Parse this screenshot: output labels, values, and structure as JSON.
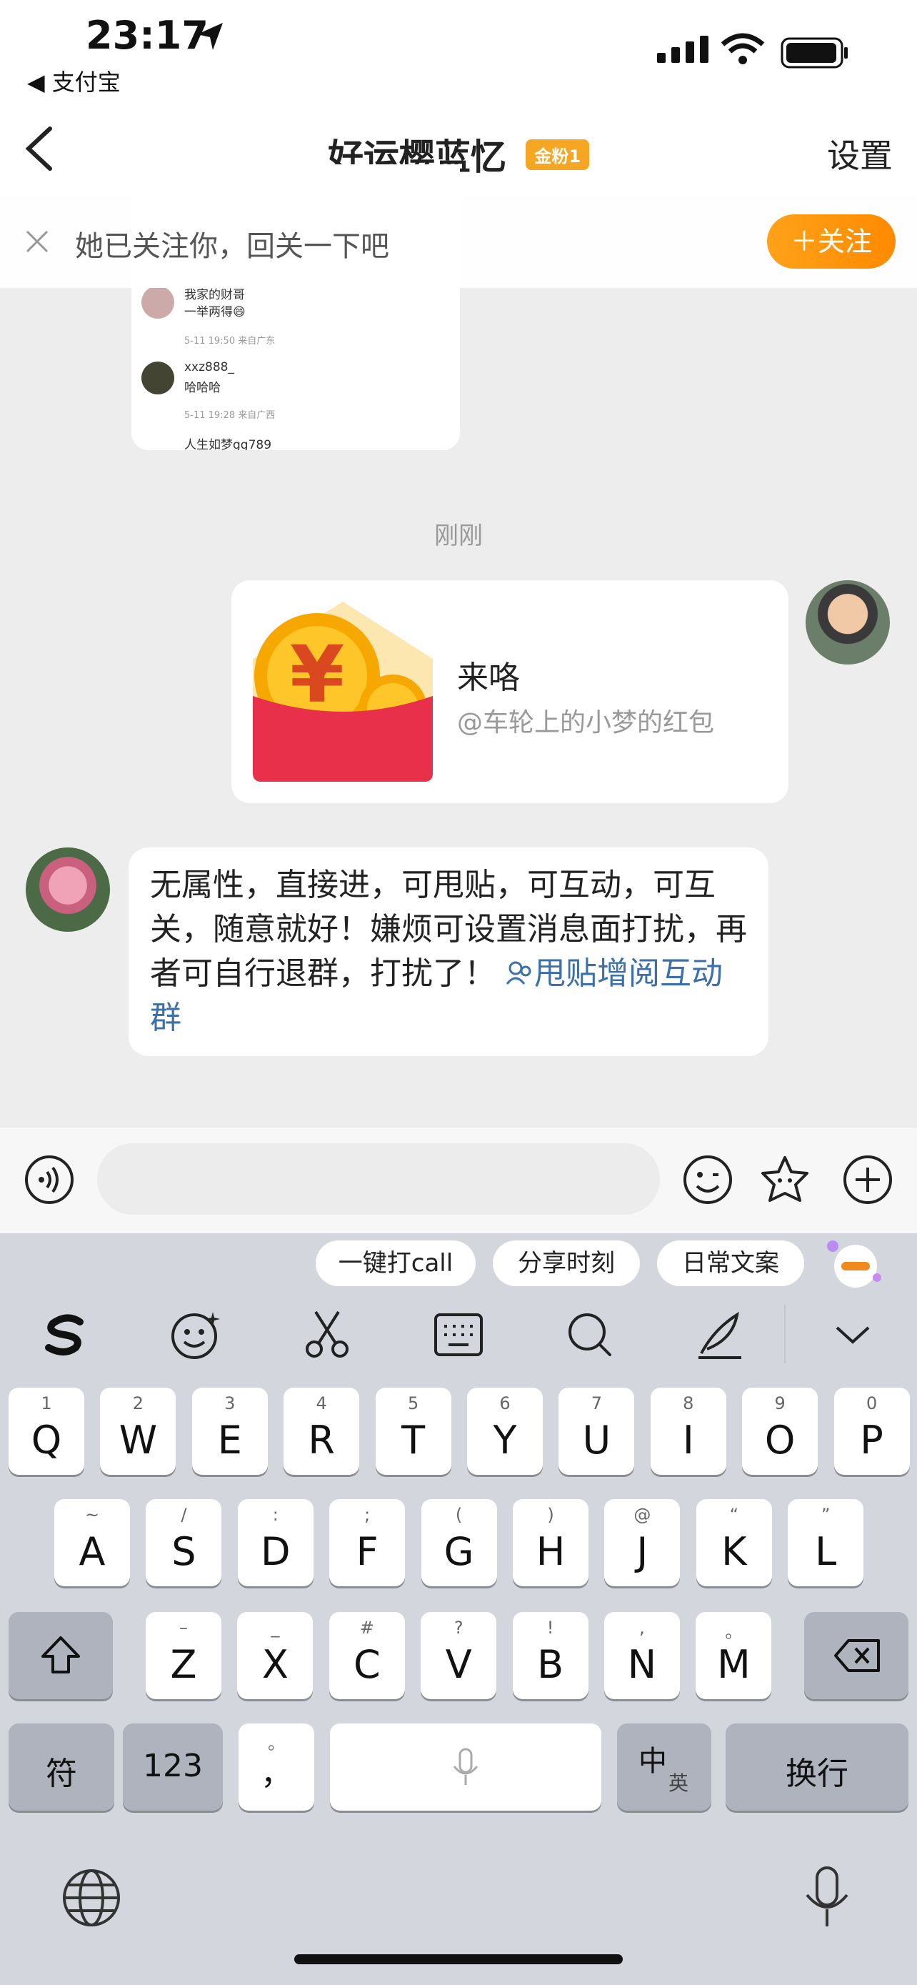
{
  "status_bar": {
    "time": "23:17",
    "back_app": "◀ 支付宝"
  },
  "nav": {
    "title": "好运樱蓝忆",
    "fan_badge": "金粉1",
    "settings": "设置"
  },
  "follow_bar": {
    "text": "她已关注你，回关一下吧",
    "button": "＋关注"
  },
  "shared_screenshot": {
    "items": [
      {
        "name": "我家的财哥",
        "text": "一举两得😄",
        "meta": "5-11 19:50 来自广东"
      },
      {
        "name": "xxz888_",
        "text": "哈哈哈",
        "meta": "5-11 19:28 来自广西"
      },
      {
        "name": "人生如梦gg789",
        "text": "",
        "meta": ""
      }
    ]
  },
  "chat": {
    "timestamp": "刚刚",
    "red_packet": {
      "title": "来咯",
      "subtitle": "@车轮上的小梦的红包"
    },
    "message": {
      "text": "无属性，直接进，可甩贴，可互动，可互关，随意就好！嫌烦可设置消息面打扰，再者可自行退群，打扰了！",
      "link": "甩贴增阅互动群"
    }
  },
  "input": {
    "placeholder": ""
  },
  "keyboard": {
    "suggestions": [
      "一键打call",
      "分享时刻",
      "日常文案"
    ],
    "row1": [
      {
        "k": "Q",
        "s": "1"
      },
      {
        "k": "W",
        "s": "2"
      },
      {
        "k": "E",
        "s": "3"
      },
      {
        "k": "R",
        "s": "4"
      },
      {
        "k": "T",
        "s": "5"
      },
      {
        "k": "Y",
        "s": "6"
      },
      {
        "k": "U",
        "s": "7"
      },
      {
        "k": "I",
        "s": "8"
      },
      {
        "k": "O",
        "s": "9"
      },
      {
        "k": "P",
        "s": "0"
      }
    ],
    "row2": [
      {
        "k": "A",
        "s": "~"
      },
      {
        "k": "S",
        "s": "/"
      },
      {
        "k": "D",
        "s": ":"
      },
      {
        "k": "F",
        "s": ";"
      },
      {
        "k": "G",
        "s": "("
      },
      {
        "k": "H",
        "s": ")"
      },
      {
        "k": "J",
        "s": "@"
      },
      {
        "k": "K",
        "s": "“"
      },
      {
        "k": "L",
        "s": "”"
      }
    ],
    "row3": [
      {
        "k": "Z",
        "s": "–"
      },
      {
        "k": "X",
        "s": "_"
      },
      {
        "k": "C",
        "s": "#"
      },
      {
        "k": "V",
        "s": "?"
      },
      {
        "k": "B",
        "s": "!"
      },
      {
        "k": "N",
        "s": ","
      },
      {
        "k": "M",
        "s": "。"
      }
    ],
    "symbol_key": "符",
    "number_key": "123",
    "punct_key_top": "。",
    "punct_key_main": "，",
    "lang_key_main": "中",
    "lang_key_sub": "英",
    "return_key": "换行"
  }
}
